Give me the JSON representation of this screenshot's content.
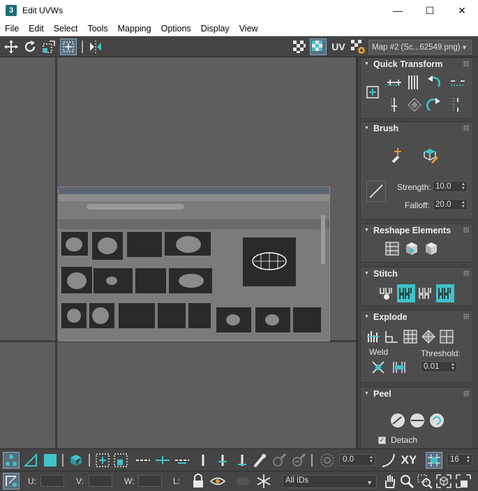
{
  "window": {
    "title": "Edit UVWs",
    "app_icon_text": "3",
    "minimize": "—",
    "maximize": "☐",
    "close": "✕"
  },
  "menu": [
    "File",
    "Edit",
    "Select",
    "Tools",
    "Mapping",
    "Options",
    "Display",
    "View"
  ],
  "toolbar": {
    "uv_label": "UV",
    "map_selector": "Map #2 (Sc...62549.png)"
  },
  "panel": {
    "quick_transform": {
      "title": "Quick Transform"
    },
    "brush": {
      "title": "Brush",
      "strength_label": "Strength:",
      "strength_value": "10.0",
      "falloff_label": "Falloff:",
      "falloff_value": "20.0"
    },
    "reshape": {
      "title": "Reshape Elements"
    },
    "stitch": {
      "title": "Stitch"
    },
    "explode": {
      "title": "Explode",
      "weld_label": "Weld",
      "threshold_label": "Threshold:",
      "threshold_value": "0.01"
    },
    "peel": {
      "title": "Peel",
      "detach_label": "Detach",
      "detach_checked": true
    }
  },
  "bottom": {
    "angle_value": "0.0",
    "xy_label": "XY",
    "snap_value": "16",
    "u_label": "U:",
    "v_label": "V:",
    "w_label": "W:",
    "l_label": "L:",
    "u_value": "",
    "v_value": "",
    "w_value": "",
    "ids_dropdown": "All IDs"
  },
  "colors": {
    "accent": "#3fc3c9",
    "panel_bg": "#444444",
    "viewport_bg": "#5e5e5e"
  }
}
